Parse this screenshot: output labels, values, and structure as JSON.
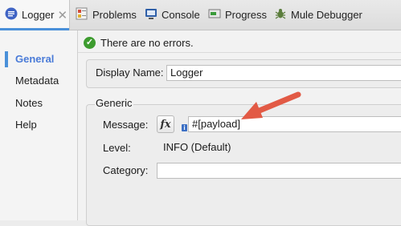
{
  "tabs": [
    {
      "label": "Logger",
      "icon": "logger-icon",
      "active": true,
      "closable": true
    },
    {
      "label": "Problems",
      "icon": "problems-icon"
    },
    {
      "label": "Console",
      "icon": "console-icon"
    },
    {
      "label": "Progress",
      "icon": "progress-icon"
    },
    {
      "label": "Mule Debugger",
      "icon": "debugger-icon"
    }
  ],
  "sidebar": {
    "items": [
      {
        "label": "General",
        "active": true
      },
      {
        "label": "Metadata"
      },
      {
        "label": "Notes"
      },
      {
        "label": "Help"
      }
    ]
  },
  "status": {
    "text": "There are no errors.",
    "icon": "check-icon"
  },
  "display_name": {
    "label": "Display Name:",
    "value": "Logger"
  },
  "generic": {
    "title": "Generic",
    "message": {
      "label": "Message:",
      "value": "#[payload]",
      "fx_label": "fx"
    },
    "level": {
      "label": "Level:",
      "value": "INFO (Default)"
    },
    "category": {
      "label": "Category:",
      "value": ""
    }
  },
  "colors": {
    "accent": "#4a90d9",
    "ok": "#3d9c2f",
    "arrow": "#e25a45"
  }
}
